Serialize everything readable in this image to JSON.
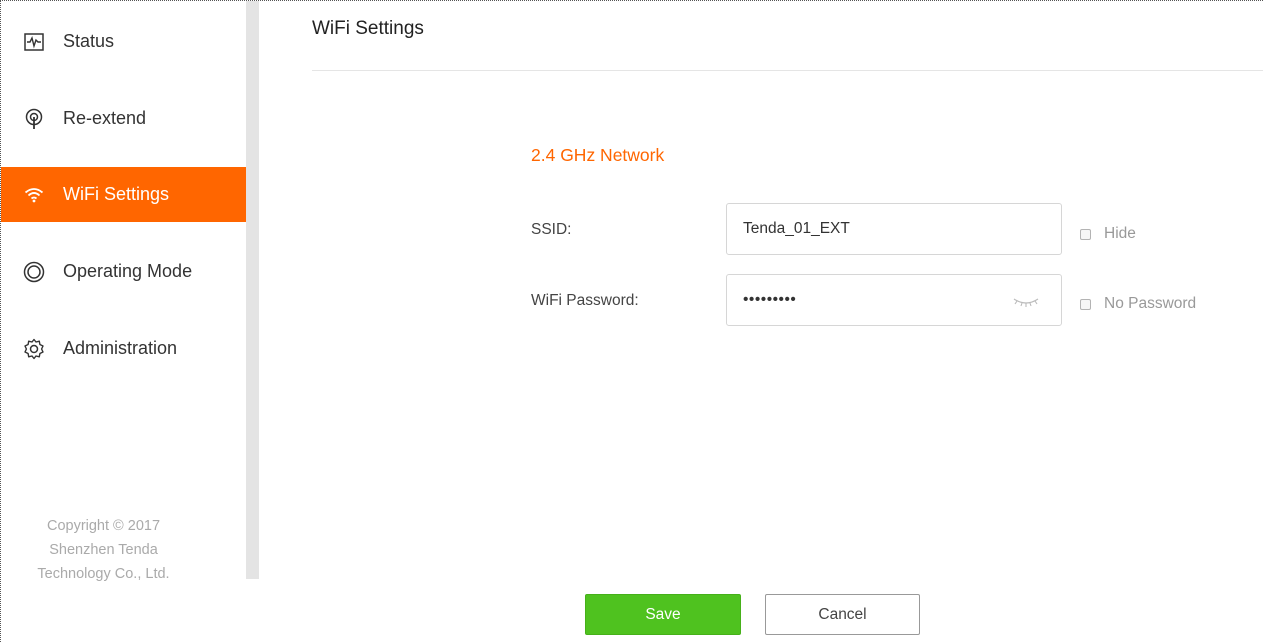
{
  "sidebar": {
    "items": [
      {
        "label": "Status",
        "icon": "status-monitor-icon",
        "active": false
      },
      {
        "label": "Re-extend",
        "icon": "re-extend-antenna-icon",
        "active": false
      },
      {
        "label": "WiFi Settings",
        "icon": "wifi-icon",
        "active": true
      },
      {
        "label": "Operating Mode",
        "icon": "operating-mode-icon",
        "active": false
      },
      {
        "label": "Administration",
        "icon": "gear-icon",
        "active": false
      }
    ],
    "copyright": {
      "line1": "Copyright © 2017",
      "line2": "Shenzhen Tenda",
      "line3": "Technology Co., Ltd."
    }
  },
  "main": {
    "title": "WiFi Settings",
    "section_title": "2.4 GHz Network",
    "ssid": {
      "label": "SSID:",
      "value": "Tenda_01_EXT",
      "hide_label": "Hide",
      "hide_checked": false
    },
    "password": {
      "label": "WiFi Password:",
      "value": "•••••••••",
      "toggle_icon": "eye-closed-icon",
      "no_password_label": "No Password",
      "no_password_checked": false
    }
  },
  "buttons": {
    "save_label": "Save",
    "cancel_label": "Cancel"
  },
  "colors": {
    "accent": "#ff6600",
    "save": "#4fc21f",
    "sidebar_scroll": "#e4e4e4",
    "muted_text": "#999999"
  }
}
